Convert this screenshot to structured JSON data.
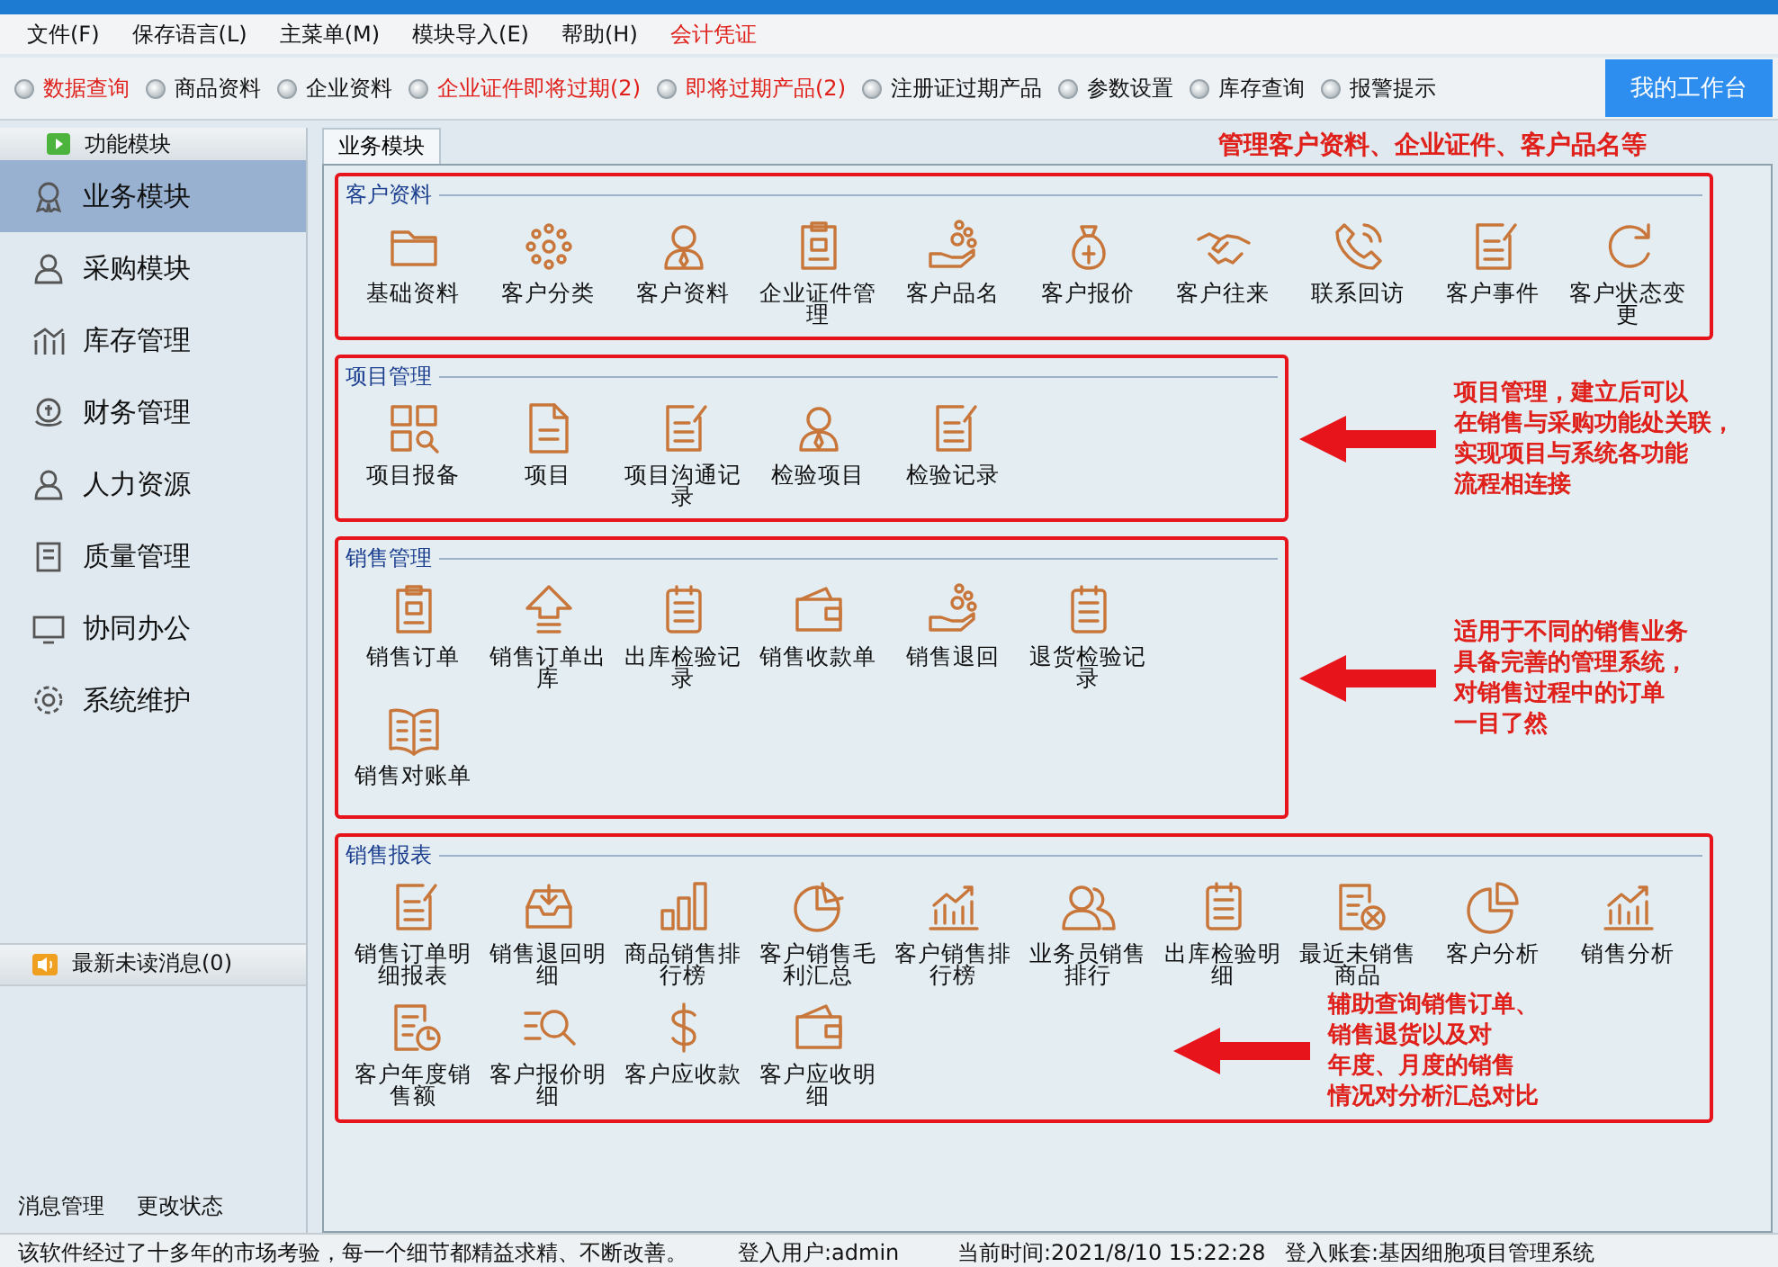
{
  "menu_bar": [
    {
      "label": "文件(F)",
      "alert": false
    },
    {
      "label": "保存语言(L)",
      "alert": false
    },
    {
      "label": "主菜单(M)",
      "alert": false
    },
    {
      "label": "模块导入(E)",
      "alert": false
    },
    {
      "label": "帮助(H)",
      "alert": false
    },
    {
      "label": "会计凭证",
      "alert": true
    }
  ],
  "quick_bar": {
    "items": [
      {
        "label": "数据查询",
        "alert": true
      },
      {
        "label": "商品资料",
        "alert": false
      },
      {
        "label": "企业资料",
        "alert": false
      },
      {
        "label": "企业证件即将过期(2)",
        "alert": true
      },
      {
        "label": "即将过期产品(2)",
        "alert": true
      },
      {
        "label": "注册证过期产品",
        "alert": false
      },
      {
        "label": "参数设置",
        "alert": false
      },
      {
        "label": "库存查询",
        "alert": false
      },
      {
        "label": "报警提示",
        "alert": false
      }
    ],
    "workbench_button": "我的工作台"
  },
  "sidebar": {
    "header": "功能模块",
    "items": [
      {
        "label": "业务模块",
        "selected": true
      },
      {
        "label": "采购模块",
        "selected": false
      },
      {
        "label": "库存管理",
        "selected": false
      },
      {
        "label": "财务管理",
        "selected": false
      },
      {
        "label": "人力资源",
        "selected": false
      },
      {
        "label": "质量管理",
        "selected": false
      },
      {
        "label": "协同办公",
        "selected": false
      },
      {
        "label": "系统维护",
        "selected": false
      }
    ],
    "messages": "最新未读消息(0)",
    "footer_links": [
      "消息管理",
      "更改状态"
    ]
  },
  "tab": {
    "label": "业务模块",
    "note": "管理客户资料、企业证件、客户品名等"
  },
  "sections": [
    {
      "title": "客户资料",
      "items": [
        "基础资料",
        "客户分类",
        "客户资料",
        "企业证件管理",
        "客户品名",
        "客户报价",
        "客户往来",
        "联系回访",
        "客户事件",
        "客户状态变更"
      ]
    },
    {
      "title": "项目管理",
      "items": [
        "项目报备",
        "项目",
        "项目沟通记录",
        "检验项目",
        "检验记录"
      ],
      "note": [
        "项目管理，建立后可以",
        "在销售与采购功能处关联，",
        "实现项目与系统各功能",
        "流程相连接"
      ]
    },
    {
      "title": "销售管理",
      "items": [
        "销售订单",
        "销售订单出库",
        "出库检验记录",
        "销售收款单",
        "销售退回",
        "退货检验记录",
        "销售对账单"
      ],
      "note": [
        "适用于不同的销售业务",
        "具备完善的管理系统，",
        "对销售过程中的订单",
        "一目了然"
      ]
    },
    {
      "title": "销售报表",
      "items": [
        "销售订单明细报表",
        "销售退回明细",
        "商品销售排行榜",
        "客户销售毛利汇总",
        "客户销售排行榜",
        "业务员销售排行",
        "出库检验明细",
        "最近未销售商品",
        "客户分析",
        "销售分析",
        "客户年度销售额",
        "客户报价明细",
        "客户应收款",
        "客户应收明细"
      ],
      "note": [
        "辅助查询销售订单、",
        "销售退货以及对",
        "年度、月度的销售",
        "情况对分析汇总对比"
      ]
    }
  ],
  "status_bar": [
    "该软件经过了十多年的市场考验，每一个细节都精益求精、不断改善。",
    "登入用户:admin",
    "当前时间:2021/8/10 15:22:28",
    "登入账套:基因细胞项目管理系统"
  ]
}
